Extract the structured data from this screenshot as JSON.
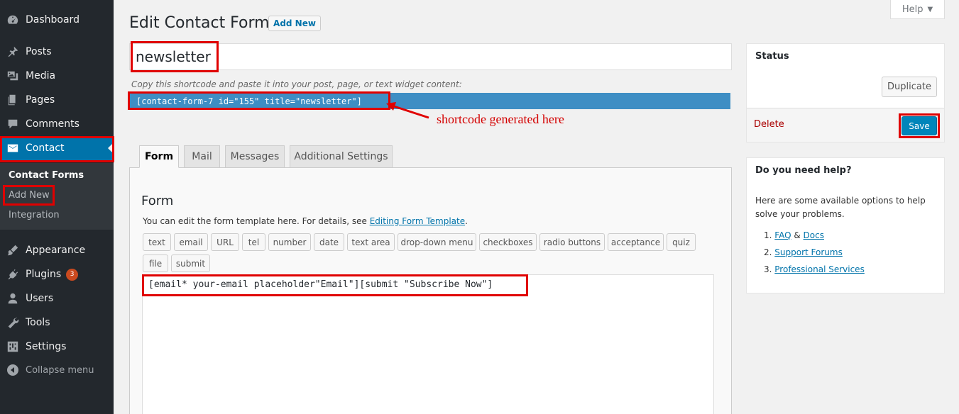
{
  "sidebar": {
    "items": [
      {
        "label": "Dashboard",
        "icon": "dashboard-icon"
      },
      {
        "label": "Posts",
        "icon": "pin-icon"
      },
      {
        "label": "Media",
        "icon": "media-icon"
      },
      {
        "label": "Pages",
        "icon": "pages-icon"
      },
      {
        "label": "Comments",
        "icon": "comment-icon"
      },
      {
        "label": "Contact",
        "icon": "envelope-icon"
      },
      {
        "label": "Appearance",
        "icon": "brush-icon"
      },
      {
        "label": "Plugins",
        "icon": "plugin-icon",
        "badge": "3"
      },
      {
        "label": "Users",
        "icon": "users-icon"
      },
      {
        "label": "Tools",
        "icon": "wrench-icon"
      },
      {
        "label": "Settings",
        "icon": "settings-icon"
      }
    ],
    "submenu": [
      "Contact Forms",
      "Add New",
      "Integration"
    ],
    "collapse": "Collapse menu"
  },
  "header": {
    "title": "Edit Contact Form",
    "add_new": "Add New",
    "help": "Help",
    "help_arrow": "▼"
  },
  "form_title_value": "newsletter",
  "shortcode": {
    "label": "Copy this shortcode and paste it into your post, page, or text widget content:",
    "value": "[contact-form-7 id=\"155\" title=\"newsletter\"]"
  },
  "annotation": "shortcode generated here",
  "tabs": [
    "Form",
    "Mail",
    "Messages",
    "Additional Settings"
  ],
  "form_panel": {
    "heading": "Form",
    "desc_prefix": "You can edit the form template here. For details, see ",
    "desc_link": "Editing Form Template",
    "desc_suffix": ".",
    "tags": [
      "text",
      "email",
      "URL",
      "tel",
      "number",
      "date",
      "text area",
      "drop-down menu",
      "checkboxes",
      "radio buttons",
      "acceptance",
      "quiz",
      "file",
      "submit"
    ],
    "template": "[email* your-email placeholder\"Email\"][submit \"Subscribe Now\"]"
  },
  "status_box": {
    "title": "Status",
    "duplicate": "Duplicate",
    "delete": "Delete",
    "save": "Save"
  },
  "help_box": {
    "title": "Do you need help?",
    "text": "Here are some available options to help solve your problems.",
    "item1_num": "1.",
    "item1_link_a": "FAQ",
    "item1_amp": " & ",
    "item1_link_b": "Docs",
    "item2_num": "2.",
    "item2_link": "Support Forums",
    "item3_num": "3.",
    "item3_link": "Professional Services"
  },
  "colors": {
    "sidebar_bg": "#23282d",
    "active_menu": "#0073aa",
    "shortcode_bar": "#3e8ec4",
    "highlight_red": "#e00000",
    "save_button": "#0085ba"
  }
}
